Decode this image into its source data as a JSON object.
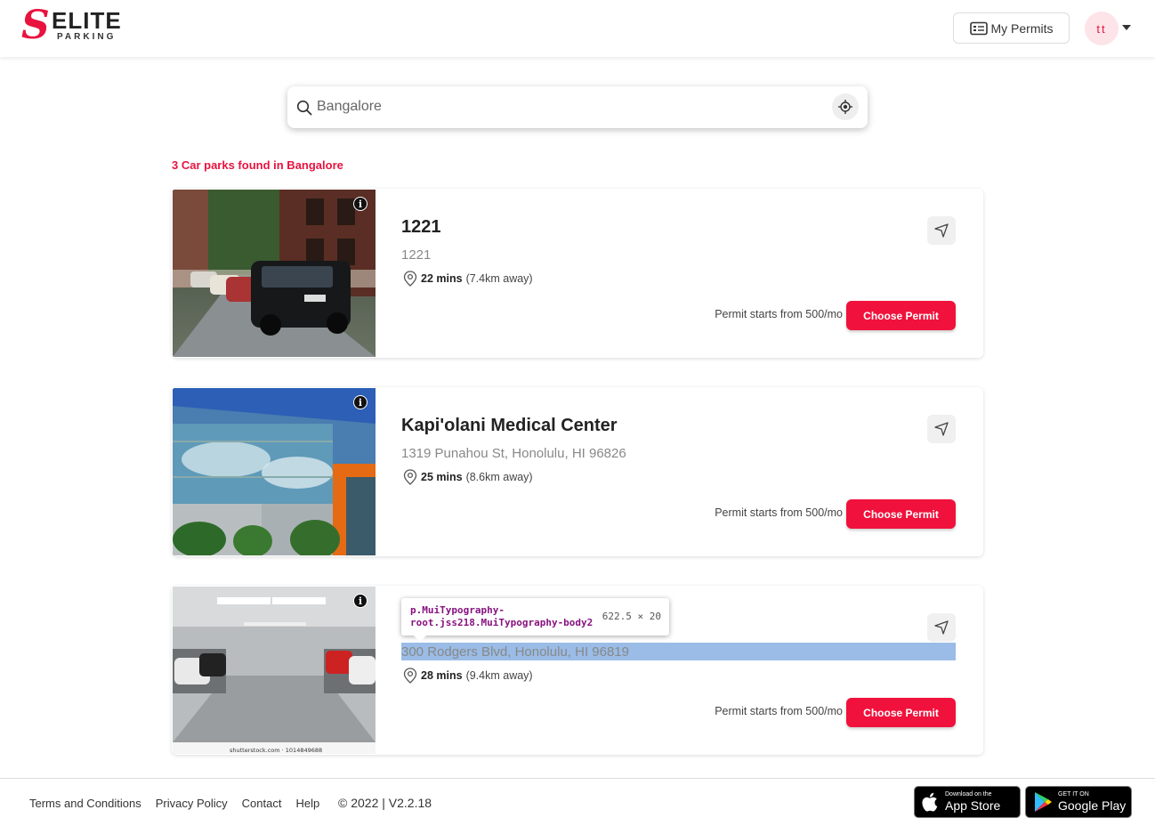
{
  "header": {
    "logo_letter": "S",
    "logo_word": "ELITE",
    "logo_sub": "PARKING",
    "my_permits": "My Permits",
    "avatar_initials": "tt"
  },
  "search": {
    "value": "Bangalore"
  },
  "results_summary": "3 Car parks found in Bangalore",
  "carparks": [
    {
      "name": "1221",
      "address": "1221",
      "time": "22 mins",
      "distance": "(7.4km away)",
      "price": "Permit starts from 500/mo",
      "button": "Choose Permit"
    },
    {
      "name": "Kapi'olani Medical Center",
      "address": "1319 Punahou St, Honolulu, HI 96826",
      "time": "25 mins",
      "distance": "(8.6km away)",
      "price": "Permit starts from 500/mo",
      "button": "Choose Permit"
    },
    {
      "name": "",
      "address": "300 Rodgers Blvd, Honolulu, HI 96819",
      "time": "28 mins",
      "distance": "(9.4km away)",
      "price": "Permit starts from 500/mo",
      "button": "Choose Permit",
      "image_caption": "shutterstock.com · 1014849688"
    }
  ],
  "inspector_tooltip": {
    "selector": "p.MuiTypography-root.jss218.MuiTypography-body2",
    "size": "622.5 × 20"
  },
  "footer": {
    "links": [
      "Terms and Conditions",
      "Privacy Policy",
      "Contact",
      "Help"
    ],
    "copyright": "© 2022 | V2.2.18",
    "app_store_small": "Download on the",
    "app_store_big": "App Store",
    "play_small": "GET IT ON",
    "play_big": "Google Play"
  },
  "colors": {
    "brand": "#e8133f",
    "button": "#f0123c"
  }
}
